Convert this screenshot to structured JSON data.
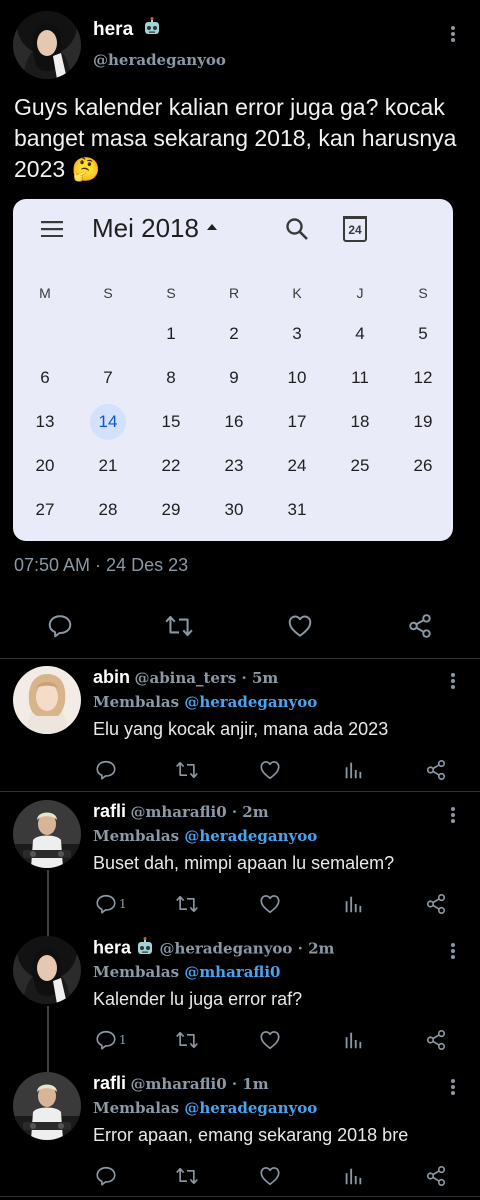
{
  "main_tweet": {
    "name": "hera",
    "handle": "@heradeganyoo",
    "text": "Guys kalender kalian error juga ga? kocak banget masa sekarang 2018, kan harusnya 2023 🤔",
    "timestamp": "07:50 AM · 24 Des 23",
    "calendar": {
      "month_label": "Mei 2018",
      "today_badge": "24",
      "weekdays": [
        "M",
        "S",
        "S",
        "R",
        "K",
        "J",
        "S"
      ],
      "days": [
        "1",
        "2",
        "3",
        "4",
        "5",
        "6",
        "7",
        "8",
        "9",
        "10",
        "11",
        "12",
        "13",
        "14",
        "15",
        "16",
        "17",
        "18",
        "19",
        "20",
        "21",
        "22",
        "23",
        "24",
        "25",
        "26",
        "27",
        "28",
        "29",
        "30",
        "31"
      ],
      "highlighted_day": "14",
      "first_weekday_index": 2
    }
  },
  "replies": [
    {
      "name": "abin",
      "handle": "@abina_ters",
      "time": " · 5m",
      "replying_prefix": "Membalas ",
      "replying_to": "@heradeganyoo",
      "text": "Elu yang kocak anjir, mana ada 2023",
      "reply_count": ""
    },
    {
      "name": "rafli",
      "handle": "@mharafli0",
      "time": " · 2m",
      "replying_prefix": "Membalas ",
      "replying_to": "@heradeganyoo",
      "text": "Buset dah, mimpi apaan lu semalem?",
      "reply_count": "1"
    },
    {
      "name": "hera",
      "handle": "@heradeganyoo",
      "time": " · 2m",
      "replying_prefix": "Membalas ",
      "replying_to": "@mharafli0",
      "text": "Kalender lu juga error raf?",
      "reply_count": "1"
    },
    {
      "name": "rafli",
      "handle": "@mharafli0",
      "time": " · 1m",
      "replying_prefix": "Membalas ",
      "replying_to": "@heradeganyoo",
      "text": "Error apaan, emang sekarang 2018 bre",
      "reply_count": ""
    }
  ],
  "icons": {
    "more": "more-vertical-icon",
    "reply": "reply-icon",
    "retweet": "retweet-icon",
    "like": "like-icon",
    "views": "views-icon",
    "share": "share-icon",
    "bot": "robot-icon",
    "menu": "hamburger-menu-icon",
    "search": "search-icon",
    "today": "calendar-today-icon"
  },
  "colors": {
    "background": "#000000",
    "text": "#e7e9ea",
    "secondary": "#8b98a5",
    "mention": "#4aa3f0",
    "calendar_bg": "#e9ecf8",
    "calendar_today_bg": "#d3e1fb"
  }
}
